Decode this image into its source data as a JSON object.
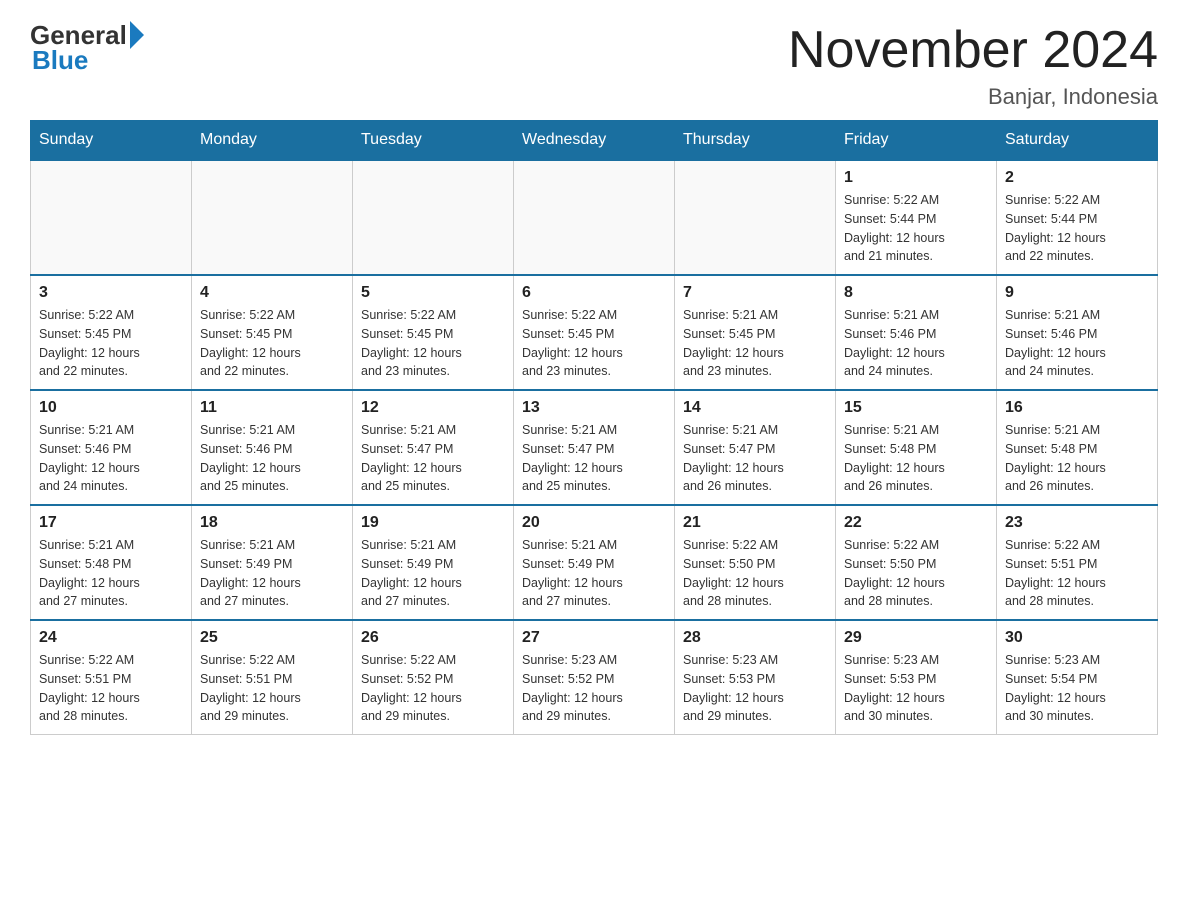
{
  "header": {
    "logo_general": "General",
    "logo_blue": "Blue",
    "month_title": "November 2024",
    "location": "Banjar, Indonesia"
  },
  "weekdays": [
    "Sunday",
    "Monday",
    "Tuesday",
    "Wednesday",
    "Thursday",
    "Friday",
    "Saturday"
  ],
  "weeks": [
    [
      {
        "day": "",
        "info": ""
      },
      {
        "day": "",
        "info": ""
      },
      {
        "day": "",
        "info": ""
      },
      {
        "day": "",
        "info": ""
      },
      {
        "day": "",
        "info": ""
      },
      {
        "day": "1",
        "info": "Sunrise: 5:22 AM\nSunset: 5:44 PM\nDaylight: 12 hours\nand 21 minutes."
      },
      {
        "day": "2",
        "info": "Sunrise: 5:22 AM\nSunset: 5:44 PM\nDaylight: 12 hours\nand 22 minutes."
      }
    ],
    [
      {
        "day": "3",
        "info": "Sunrise: 5:22 AM\nSunset: 5:45 PM\nDaylight: 12 hours\nand 22 minutes."
      },
      {
        "day": "4",
        "info": "Sunrise: 5:22 AM\nSunset: 5:45 PM\nDaylight: 12 hours\nand 22 minutes."
      },
      {
        "day": "5",
        "info": "Sunrise: 5:22 AM\nSunset: 5:45 PM\nDaylight: 12 hours\nand 23 minutes."
      },
      {
        "day": "6",
        "info": "Sunrise: 5:22 AM\nSunset: 5:45 PM\nDaylight: 12 hours\nand 23 minutes."
      },
      {
        "day": "7",
        "info": "Sunrise: 5:21 AM\nSunset: 5:45 PM\nDaylight: 12 hours\nand 23 minutes."
      },
      {
        "day": "8",
        "info": "Sunrise: 5:21 AM\nSunset: 5:46 PM\nDaylight: 12 hours\nand 24 minutes."
      },
      {
        "day": "9",
        "info": "Sunrise: 5:21 AM\nSunset: 5:46 PM\nDaylight: 12 hours\nand 24 minutes."
      }
    ],
    [
      {
        "day": "10",
        "info": "Sunrise: 5:21 AM\nSunset: 5:46 PM\nDaylight: 12 hours\nand 24 minutes."
      },
      {
        "day": "11",
        "info": "Sunrise: 5:21 AM\nSunset: 5:46 PM\nDaylight: 12 hours\nand 25 minutes."
      },
      {
        "day": "12",
        "info": "Sunrise: 5:21 AM\nSunset: 5:47 PM\nDaylight: 12 hours\nand 25 minutes."
      },
      {
        "day": "13",
        "info": "Sunrise: 5:21 AM\nSunset: 5:47 PM\nDaylight: 12 hours\nand 25 minutes."
      },
      {
        "day": "14",
        "info": "Sunrise: 5:21 AM\nSunset: 5:47 PM\nDaylight: 12 hours\nand 26 minutes."
      },
      {
        "day": "15",
        "info": "Sunrise: 5:21 AM\nSunset: 5:48 PM\nDaylight: 12 hours\nand 26 minutes."
      },
      {
        "day": "16",
        "info": "Sunrise: 5:21 AM\nSunset: 5:48 PM\nDaylight: 12 hours\nand 26 minutes."
      }
    ],
    [
      {
        "day": "17",
        "info": "Sunrise: 5:21 AM\nSunset: 5:48 PM\nDaylight: 12 hours\nand 27 minutes."
      },
      {
        "day": "18",
        "info": "Sunrise: 5:21 AM\nSunset: 5:49 PM\nDaylight: 12 hours\nand 27 minutes."
      },
      {
        "day": "19",
        "info": "Sunrise: 5:21 AM\nSunset: 5:49 PM\nDaylight: 12 hours\nand 27 minutes."
      },
      {
        "day": "20",
        "info": "Sunrise: 5:21 AM\nSunset: 5:49 PM\nDaylight: 12 hours\nand 27 minutes."
      },
      {
        "day": "21",
        "info": "Sunrise: 5:22 AM\nSunset: 5:50 PM\nDaylight: 12 hours\nand 28 minutes."
      },
      {
        "day": "22",
        "info": "Sunrise: 5:22 AM\nSunset: 5:50 PM\nDaylight: 12 hours\nand 28 minutes."
      },
      {
        "day": "23",
        "info": "Sunrise: 5:22 AM\nSunset: 5:51 PM\nDaylight: 12 hours\nand 28 minutes."
      }
    ],
    [
      {
        "day": "24",
        "info": "Sunrise: 5:22 AM\nSunset: 5:51 PM\nDaylight: 12 hours\nand 28 minutes."
      },
      {
        "day": "25",
        "info": "Sunrise: 5:22 AM\nSunset: 5:51 PM\nDaylight: 12 hours\nand 29 minutes."
      },
      {
        "day": "26",
        "info": "Sunrise: 5:22 AM\nSunset: 5:52 PM\nDaylight: 12 hours\nand 29 minutes."
      },
      {
        "day": "27",
        "info": "Sunrise: 5:23 AM\nSunset: 5:52 PM\nDaylight: 12 hours\nand 29 minutes."
      },
      {
        "day": "28",
        "info": "Sunrise: 5:23 AM\nSunset: 5:53 PM\nDaylight: 12 hours\nand 29 minutes."
      },
      {
        "day": "29",
        "info": "Sunrise: 5:23 AM\nSunset: 5:53 PM\nDaylight: 12 hours\nand 30 minutes."
      },
      {
        "day": "30",
        "info": "Sunrise: 5:23 AM\nSunset: 5:54 PM\nDaylight: 12 hours\nand 30 minutes."
      }
    ]
  ]
}
